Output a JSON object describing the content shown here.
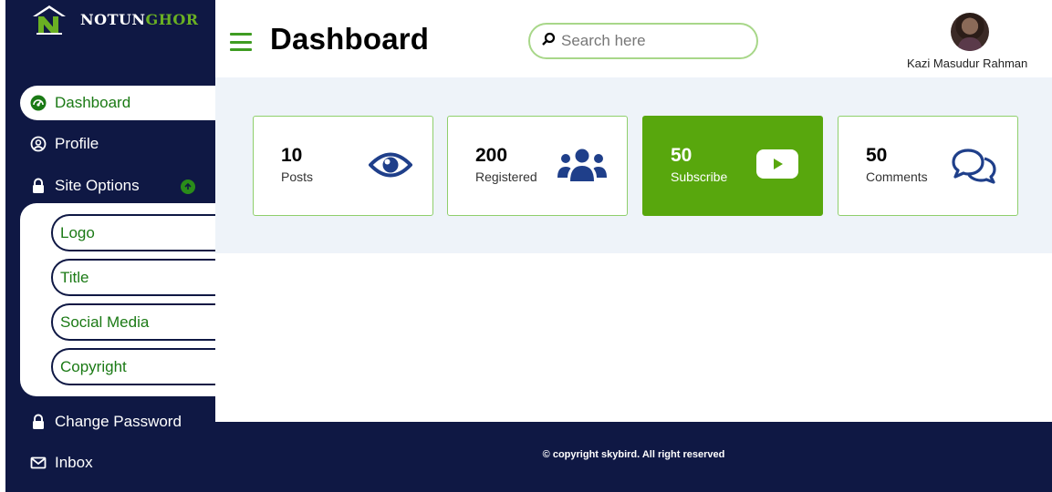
{
  "brand": {
    "name_part1": "NOTUN",
    "name_part2": "GHOR",
    "accent": "#6ab023",
    "navy": "#0f1844"
  },
  "sidebar": {
    "items": [
      {
        "label": "Dashboard",
        "icon": "speedometer-icon",
        "active": true
      },
      {
        "label": "Profile",
        "icon": "user-circle-icon"
      },
      {
        "label": "Site Options",
        "icon": "lock-icon"
      },
      {
        "label": "Change Password",
        "icon": "lock-icon"
      },
      {
        "label": "Inbox",
        "icon": "envelope-icon"
      }
    ],
    "site_options_sub": [
      "Logo",
      "Title",
      "Social Media",
      "Copyright"
    ]
  },
  "header": {
    "title": "Dashboard",
    "search_placeholder": "Search here",
    "user_name": "Kazi Masudur Rahman"
  },
  "cards": [
    {
      "value": "10",
      "label": "Posts",
      "icon": "eye-icon"
    },
    {
      "value": "200",
      "label": "Registered",
      "icon": "users-icon"
    },
    {
      "value": "50",
      "label": "Subscribe",
      "icon": "youtube-icon"
    },
    {
      "value": "50",
      "label": "Comments",
      "icon": "comments-icon"
    }
  ],
  "footer": {
    "text": "© copyright skybird. All right reserved"
  }
}
